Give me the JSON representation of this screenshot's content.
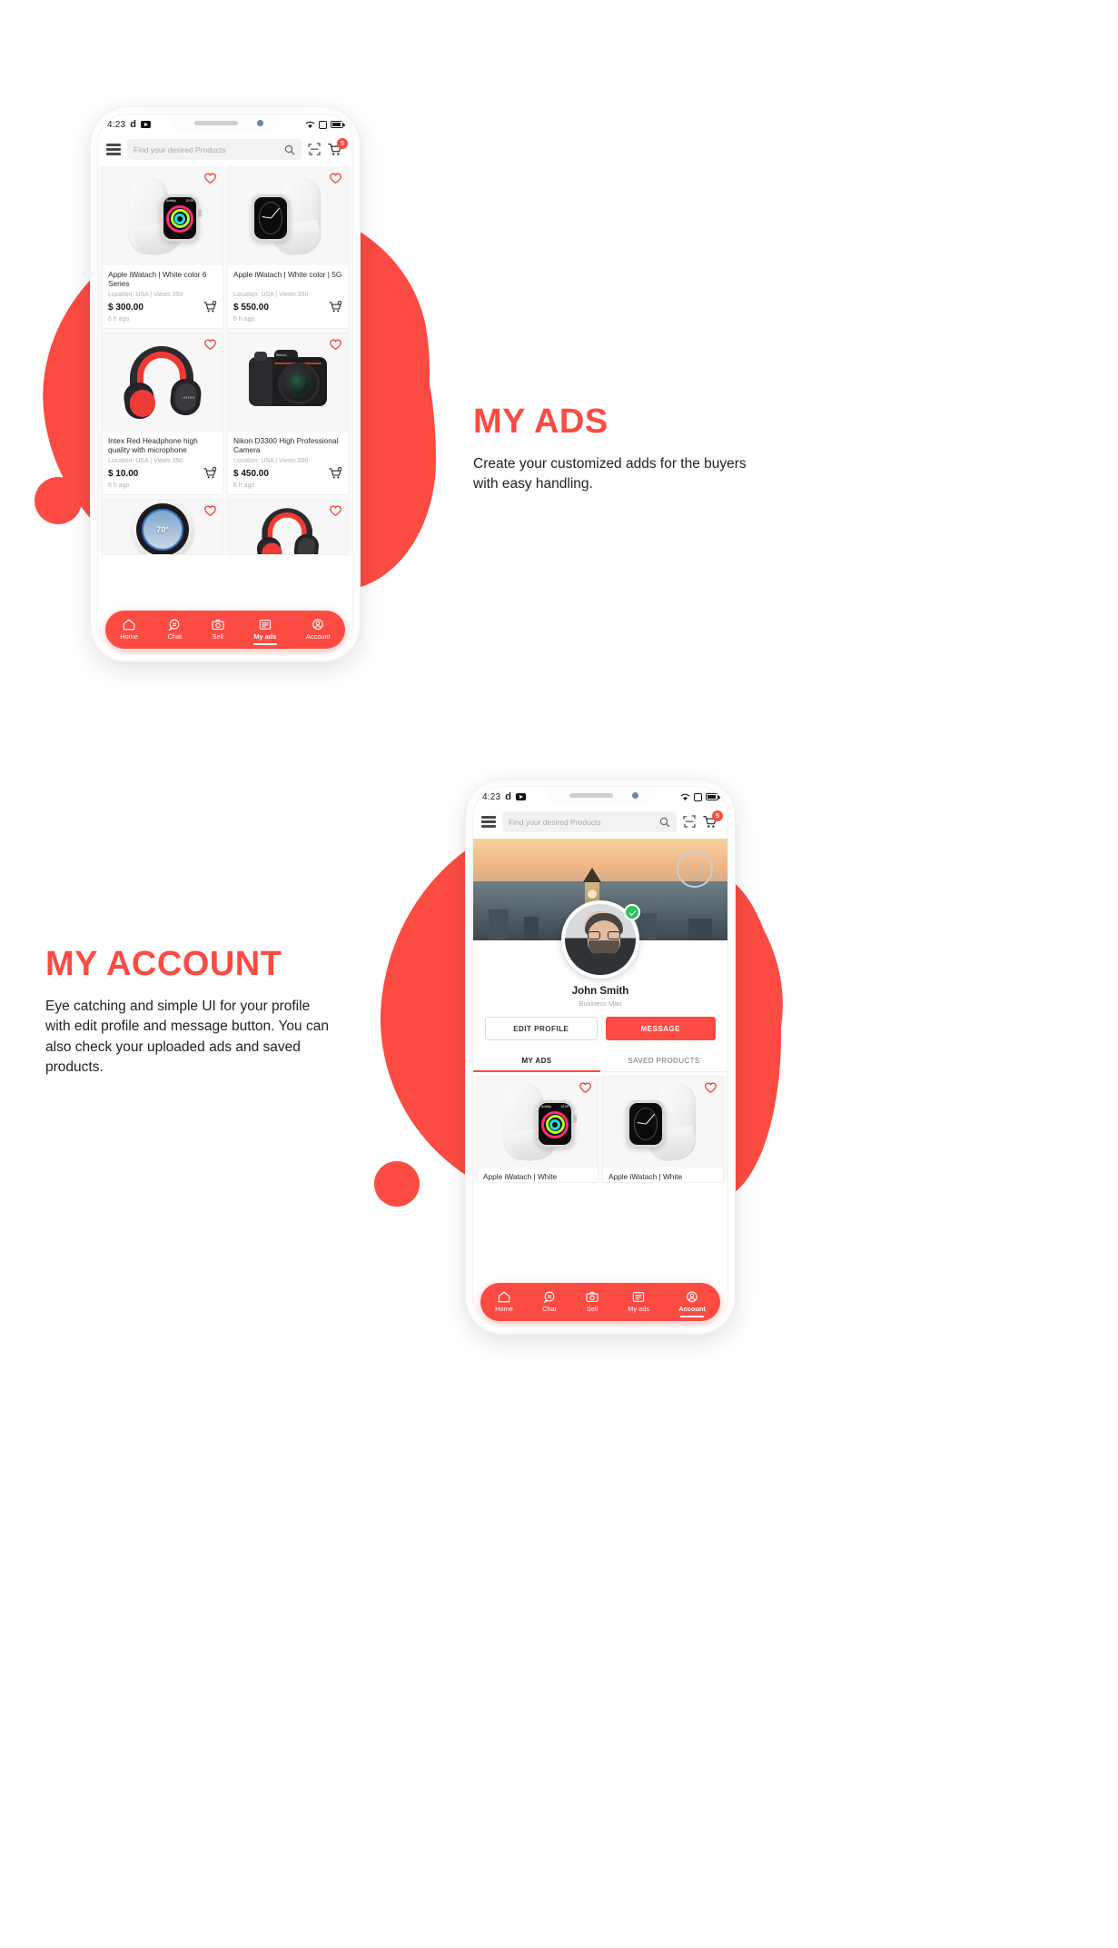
{
  "theme": {
    "accent": "#fb4b42",
    "text_dark": "#222222",
    "muted": "#b0b0b4"
  },
  "sections": [
    {
      "id": "my-ads",
      "heading": "MY ADS",
      "body": "Create your customized adds for the buyers with easy handling."
    },
    {
      "id": "my-account",
      "heading": "MY ACCOUNT",
      "body": "Eye catching and simple UI for your profile with edit profile and message button. You can also check your uploaded ads and saved products."
    }
  ],
  "status_bar": {
    "time": "4:23",
    "app_glyph": "d",
    "video_icon": "youtube-icon"
  },
  "appbar": {
    "menu_icon": "list-menu-icon",
    "search_placeholder": "Find your desired Products",
    "search_icon": "search-icon",
    "scan_icon": "scan-icon",
    "cart_icon": "cart-icon",
    "cart_badge": "5"
  },
  "bottom_nav": {
    "items": [
      {
        "label": "Home",
        "icon": "home-icon",
        "active": false
      },
      {
        "label": "Chat",
        "icon": "chat-bubble-icon",
        "active": false
      },
      {
        "label": "Sell",
        "icon": "camera-icon",
        "active": false
      },
      {
        "label": "My ads",
        "icon": "ads-icon",
        "active": true
      },
      {
        "label": "Account",
        "icon": "account-icon",
        "active": false
      }
    ],
    "items_account": [
      {
        "label": "Home",
        "icon": "home-icon",
        "active": false
      },
      {
        "label": "Chat",
        "icon": "chat-bubble-icon",
        "active": false
      },
      {
        "label": "Sell",
        "icon": "camera-icon",
        "active": false
      },
      {
        "label": "My ads",
        "icon": "ads-icon",
        "active": false
      },
      {
        "label": "Account",
        "icon": "account-icon",
        "active": true
      }
    ]
  },
  "ads_screen": {
    "products": [
      {
        "title": "Apple iWatach | White color 6 Series",
        "meta": "Location: USA | Views 350",
        "price": "$ 300.00",
        "time": "6 h ago",
        "image": "apple-watch-activity-rings",
        "favorite_icon": "heart-outline-icon",
        "cart_icon": "add-to-cart-icon"
      },
      {
        "title": "Apple iWatach | White color | 5G",
        "meta": "Location: USA | Views 350",
        "price": "$ 550.00",
        "time": "6 h ago",
        "image": "apple-watch-dark-face",
        "favorite_icon": "heart-outline-icon",
        "cart_icon": "add-to-cart-icon"
      },
      {
        "title": "Intex Red Headphone high quality with microphone",
        "meta": "Location: USA | Views 350",
        "price": "$ 10.00",
        "time": "6 h ago",
        "image": "red-black-headphone",
        "favorite_icon": "heart-outline-icon",
        "cart_icon": "add-to-cart-icon"
      },
      {
        "title": "Nikon D3300 High Professional Camera",
        "meta": "Location: USA | Views 350",
        "price": "$ 450.00",
        "time": "6 h ago",
        "image": "nikon-dslr-camera",
        "favorite_icon": "heart-outline-icon",
        "cart_icon": "add-to-cart-icon"
      },
      {
        "title": "",
        "meta": "",
        "price": "",
        "time": "",
        "image": "nest-thermostat",
        "temp_label": "70°",
        "favorite_icon": "heart-outline-icon",
        "cart_icon": "add-to-cart-icon"
      },
      {
        "title": "",
        "meta": "",
        "price": "",
        "time": "",
        "image": "red-black-headphone-2",
        "favorite_icon": "heart-outline-icon",
        "cart_icon": "add-to-cart-icon"
      }
    ]
  },
  "account_screen": {
    "cover_image": "london-skyline-big-ben",
    "avatar": "user-photo",
    "verified_icon": "verified-check-icon",
    "name": "John Smith",
    "role": "Business Man",
    "edit_profile_label": "EDIT PROFILE",
    "message_label": "MESSAGE",
    "tabs": [
      {
        "label": "MY ADS",
        "active": true
      },
      {
        "label": "SAVED PRODUCTS",
        "active": false
      }
    ],
    "products": [
      {
        "title": "Apple iWatach | White",
        "image": "apple-watch-activity-rings",
        "favorite_icon": "heart-outline-icon"
      },
      {
        "title": "Apple iWatach | White",
        "image": "apple-watch-dark-face",
        "favorite_icon": "heart-outline-icon"
      }
    ]
  }
}
